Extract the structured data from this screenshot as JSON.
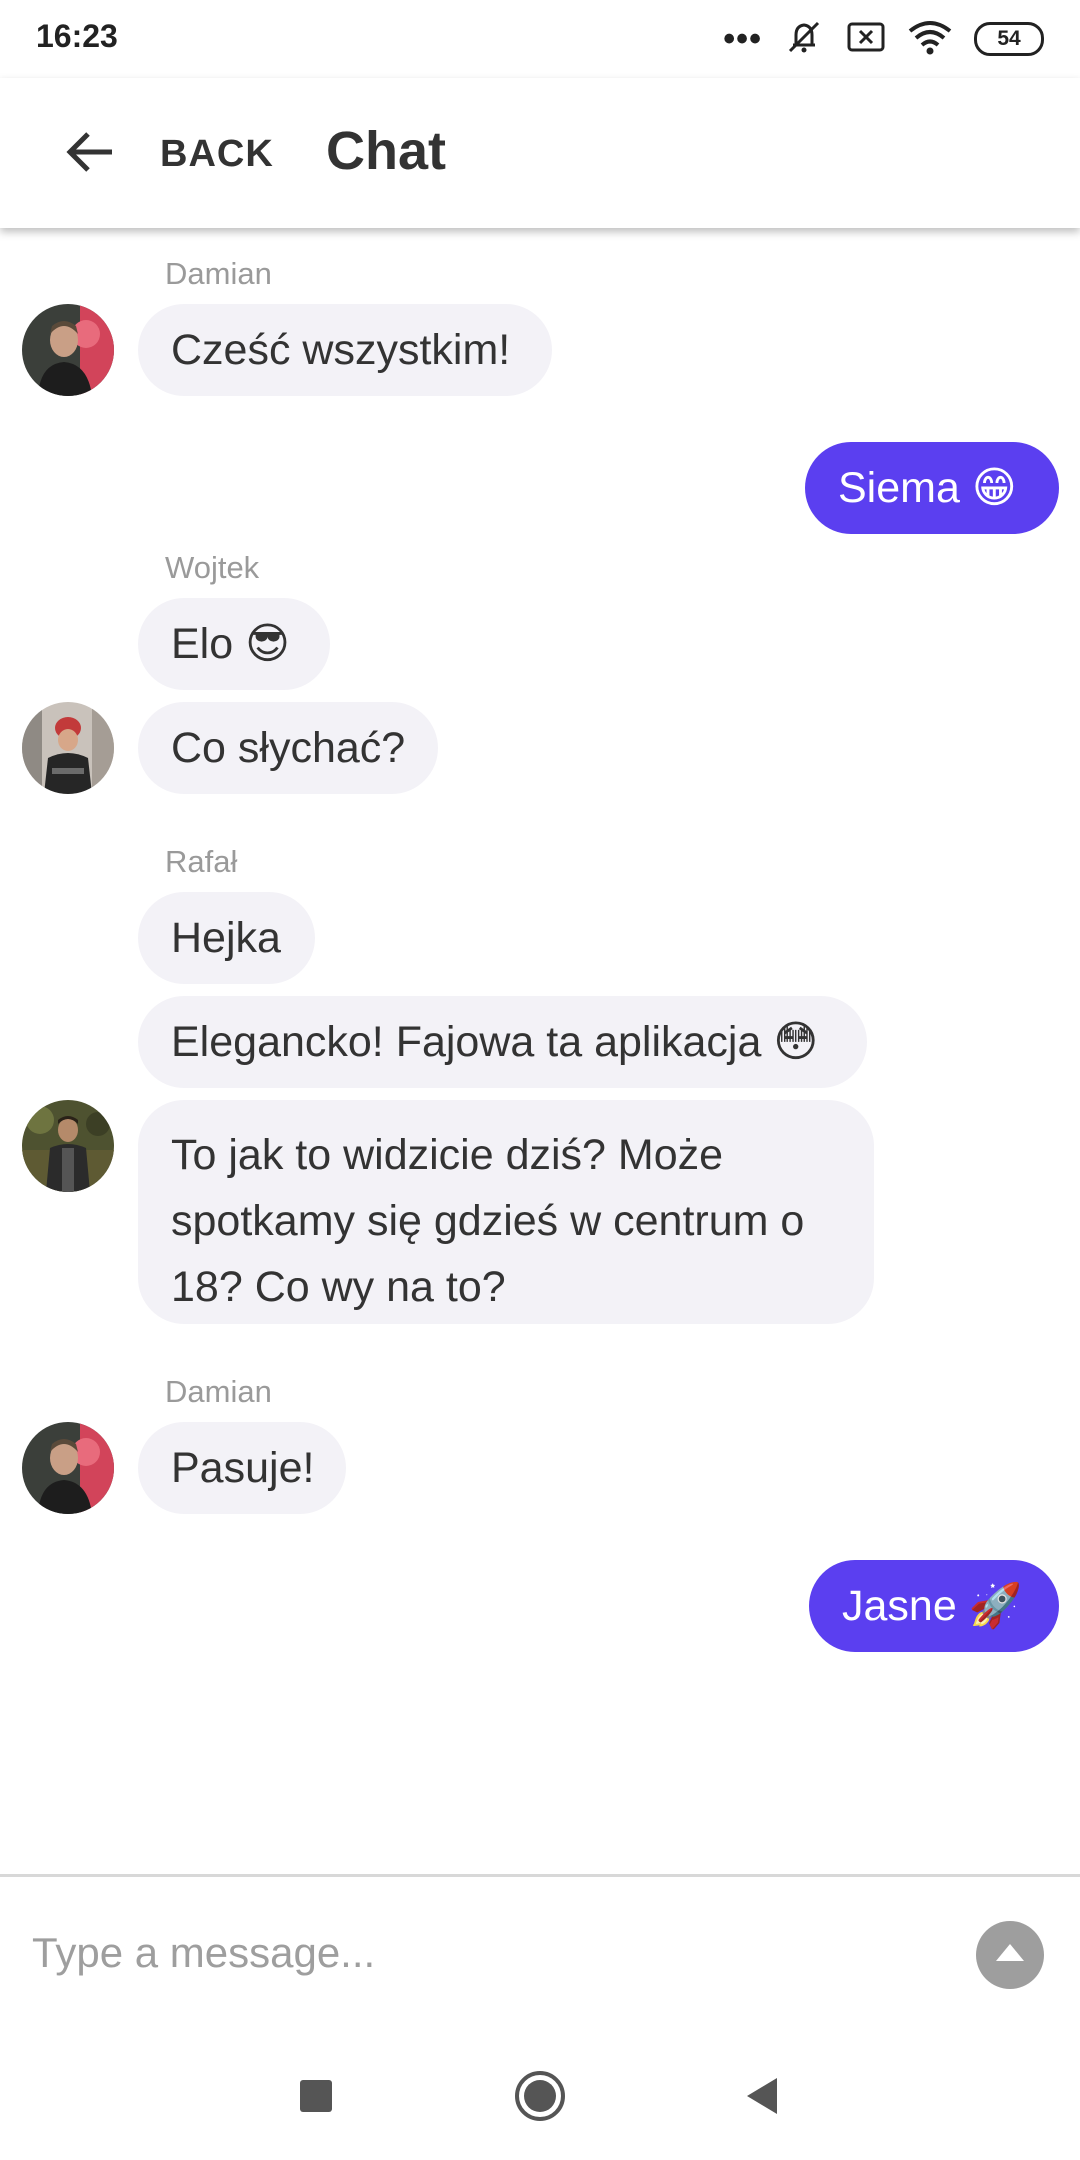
{
  "status_bar": {
    "time": "16:23",
    "battery": "54",
    "icons": [
      "more-dots-icon",
      "bell-off-icon",
      "sim-x-icon",
      "wifi-icon",
      "battery-icon"
    ]
  },
  "app_bar": {
    "back_label": "BACK",
    "title": "Chat"
  },
  "messages": {
    "damian_1": {
      "sender": "Damian",
      "text": "Cześć wszystkim!"
    },
    "me_1": {
      "text": "Siema 😁"
    },
    "wojtek": {
      "sender": "Wojtek",
      "texts": [
        "Elo 😎",
        "Co słychać?"
      ]
    },
    "rafal": {
      "sender": "Rafał",
      "texts": [
        "Hejka",
        "Elegancko! Fajowa ta aplikacja 😳",
        "To jak to widzicie dziś? Może spotkamy się gdzieś w centrum o 18? Co wy na to?"
      ]
    },
    "damian_2": {
      "sender": "Damian",
      "text": "Pasuje!"
    },
    "me_2": {
      "text": "Jasne 🚀"
    }
  },
  "composer": {
    "placeholder": "Type a message...",
    "value": ""
  },
  "colors": {
    "accent": "#5b3ff0",
    "bubble_other": "#f3f2f7",
    "sender_name": "#9a9a9a"
  },
  "nav_bar": {
    "icons": [
      "square-recents-icon",
      "circle-home-icon",
      "triangle-back-icon"
    ]
  }
}
